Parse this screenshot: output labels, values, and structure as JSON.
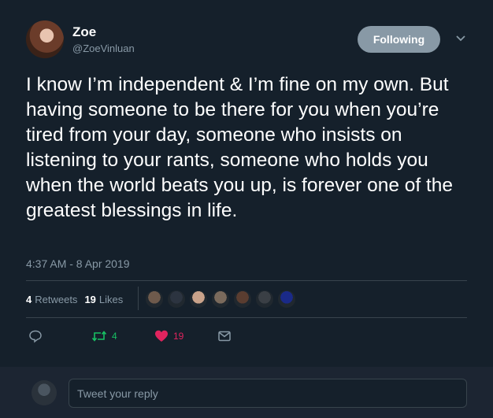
{
  "author": {
    "name": "Zoe",
    "handle": "@ZoeVinluan",
    "follow_label": "Following"
  },
  "tweet": {
    "text": "I know I’m independent & I’m fine on my own. But having someone to be there for you when you’re tired from your day, someone who insists on listening to your rants, someone who holds you when the world beats you up, is forever one of the greatest blessings in life.",
    "timestamp": "4:37 AM - 8 Apr 2019"
  },
  "stats": {
    "retweets_count": "4",
    "retweets_label": "Retweets",
    "likes_count": "19",
    "likes_label": "Likes"
  },
  "liker_avatars": [
    {
      "icon": "avatar",
      "color": "#6e5a4c"
    },
    {
      "icon": "avatar",
      "color": "#2c3440"
    },
    {
      "icon": "avatar",
      "color": "#c9a28a"
    },
    {
      "icon": "avatar",
      "color": "#7a6a5c"
    },
    {
      "icon": "avatar",
      "color": "#5a3d30"
    },
    {
      "icon": "avatar",
      "color": "#3a3f45"
    },
    {
      "icon": "avatar",
      "color": "#1a2a88"
    }
  ],
  "actions": {
    "retweet_count": "4",
    "like_count": "19"
  },
  "reply": {
    "placeholder": "Tweet your reply"
  },
  "colors": {
    "background": "#15202b",
    "secondary_text": "#8899a6",
    "retweet_green": "#17bf63",
    "like_red": "#e0245e",
    "divider": "#38444d"
  }
}
